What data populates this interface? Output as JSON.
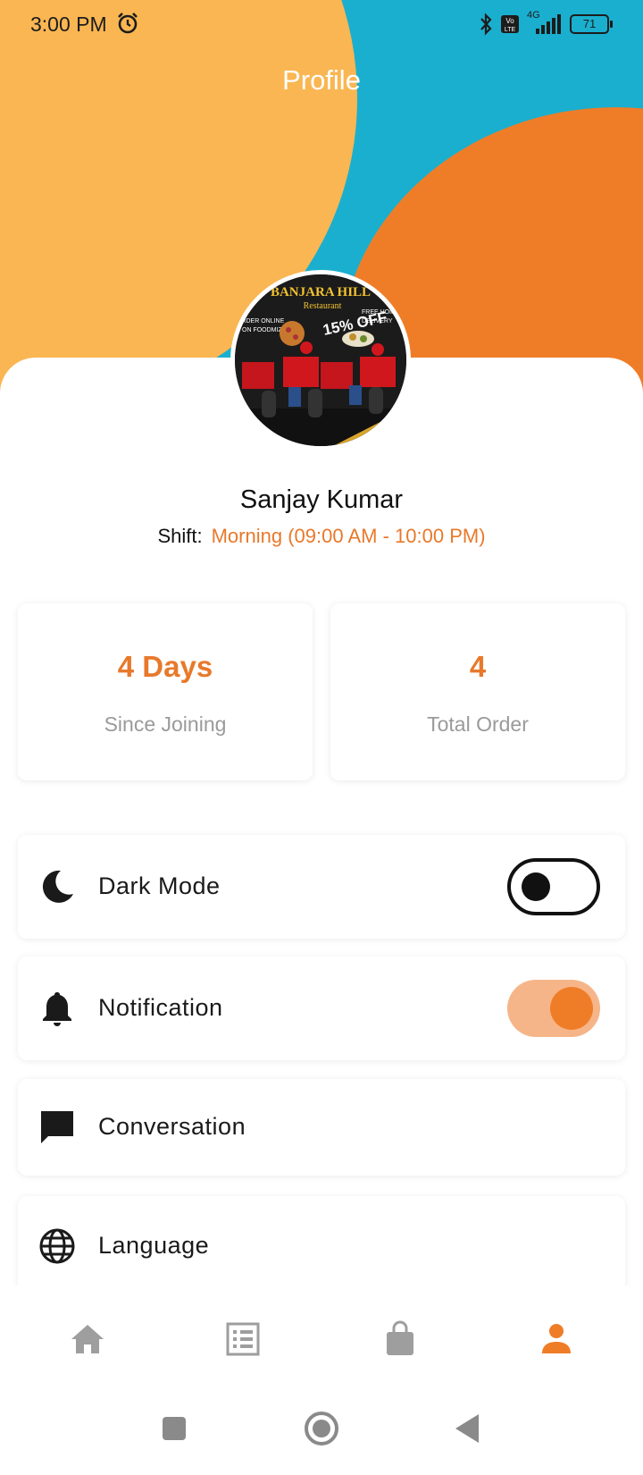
{
  "status_bar": {
    "time": "3:00 PM",
    "network": "4G",
    "battery": "71"
  },
  "header": {
    "title": "Profile"
  },
  "profile": {
    "avatar_text": {
      "restaurant": "BANJARA HILL",
      "sub": "Restaurant",
      "offer": "15% OFF",
      "order": "ORDER ONLINE",
      "order2": "ON FOODMIZA",
      "free": "FREE HOME",
      "delivery": "DELIVERY",
      "faster": "Faster Deli"
    },
    "name": "Sanjay Kumar",
    "shift_label": "Shift:",
    "shift_value": "Morning (09:00 AM - 10:00 PM)"
  },
  "stats": [
    {
      "value": "4 Days",
      "label": "Since Joining"
    },
    {
      "value": "4",
      "label": "Total Order"
    }
  ],
  "settings": [
    {
      "label": "Dark Mode",
      "icon": "moon-icon",
      "toggle": "off"
    },
    {
      "label": "Notification",
      "icon": "bell-icon",
      "toggle": "on"
    },
    {
      "label": "Conversation",
      "icon": "chat-icon"
    },
    {
      "label": "Language",
      "icon": "globe-icon"
    }
  ],
  "bottom_nav": [
    {
      "name": "home",
      "icon": "home-icon",
      "active": false
    },
    {
      "name": "orders",
      "icon": "list-icon",
      "active": false
    },
    {
      "name": "bag",
      "icon": "shopping-bag-icon",
      "active": false
    },
    {
      "name": "profile",
      "icon": "person-icon",
      "active": true
    }
  ],
  "colors": {
    "accent": "#EF7D27",
    "yellow": "#FAB652",
    "cyan": "#1AAFCF",
    "inactive_icon": "#9E9E9E"
  }
}
